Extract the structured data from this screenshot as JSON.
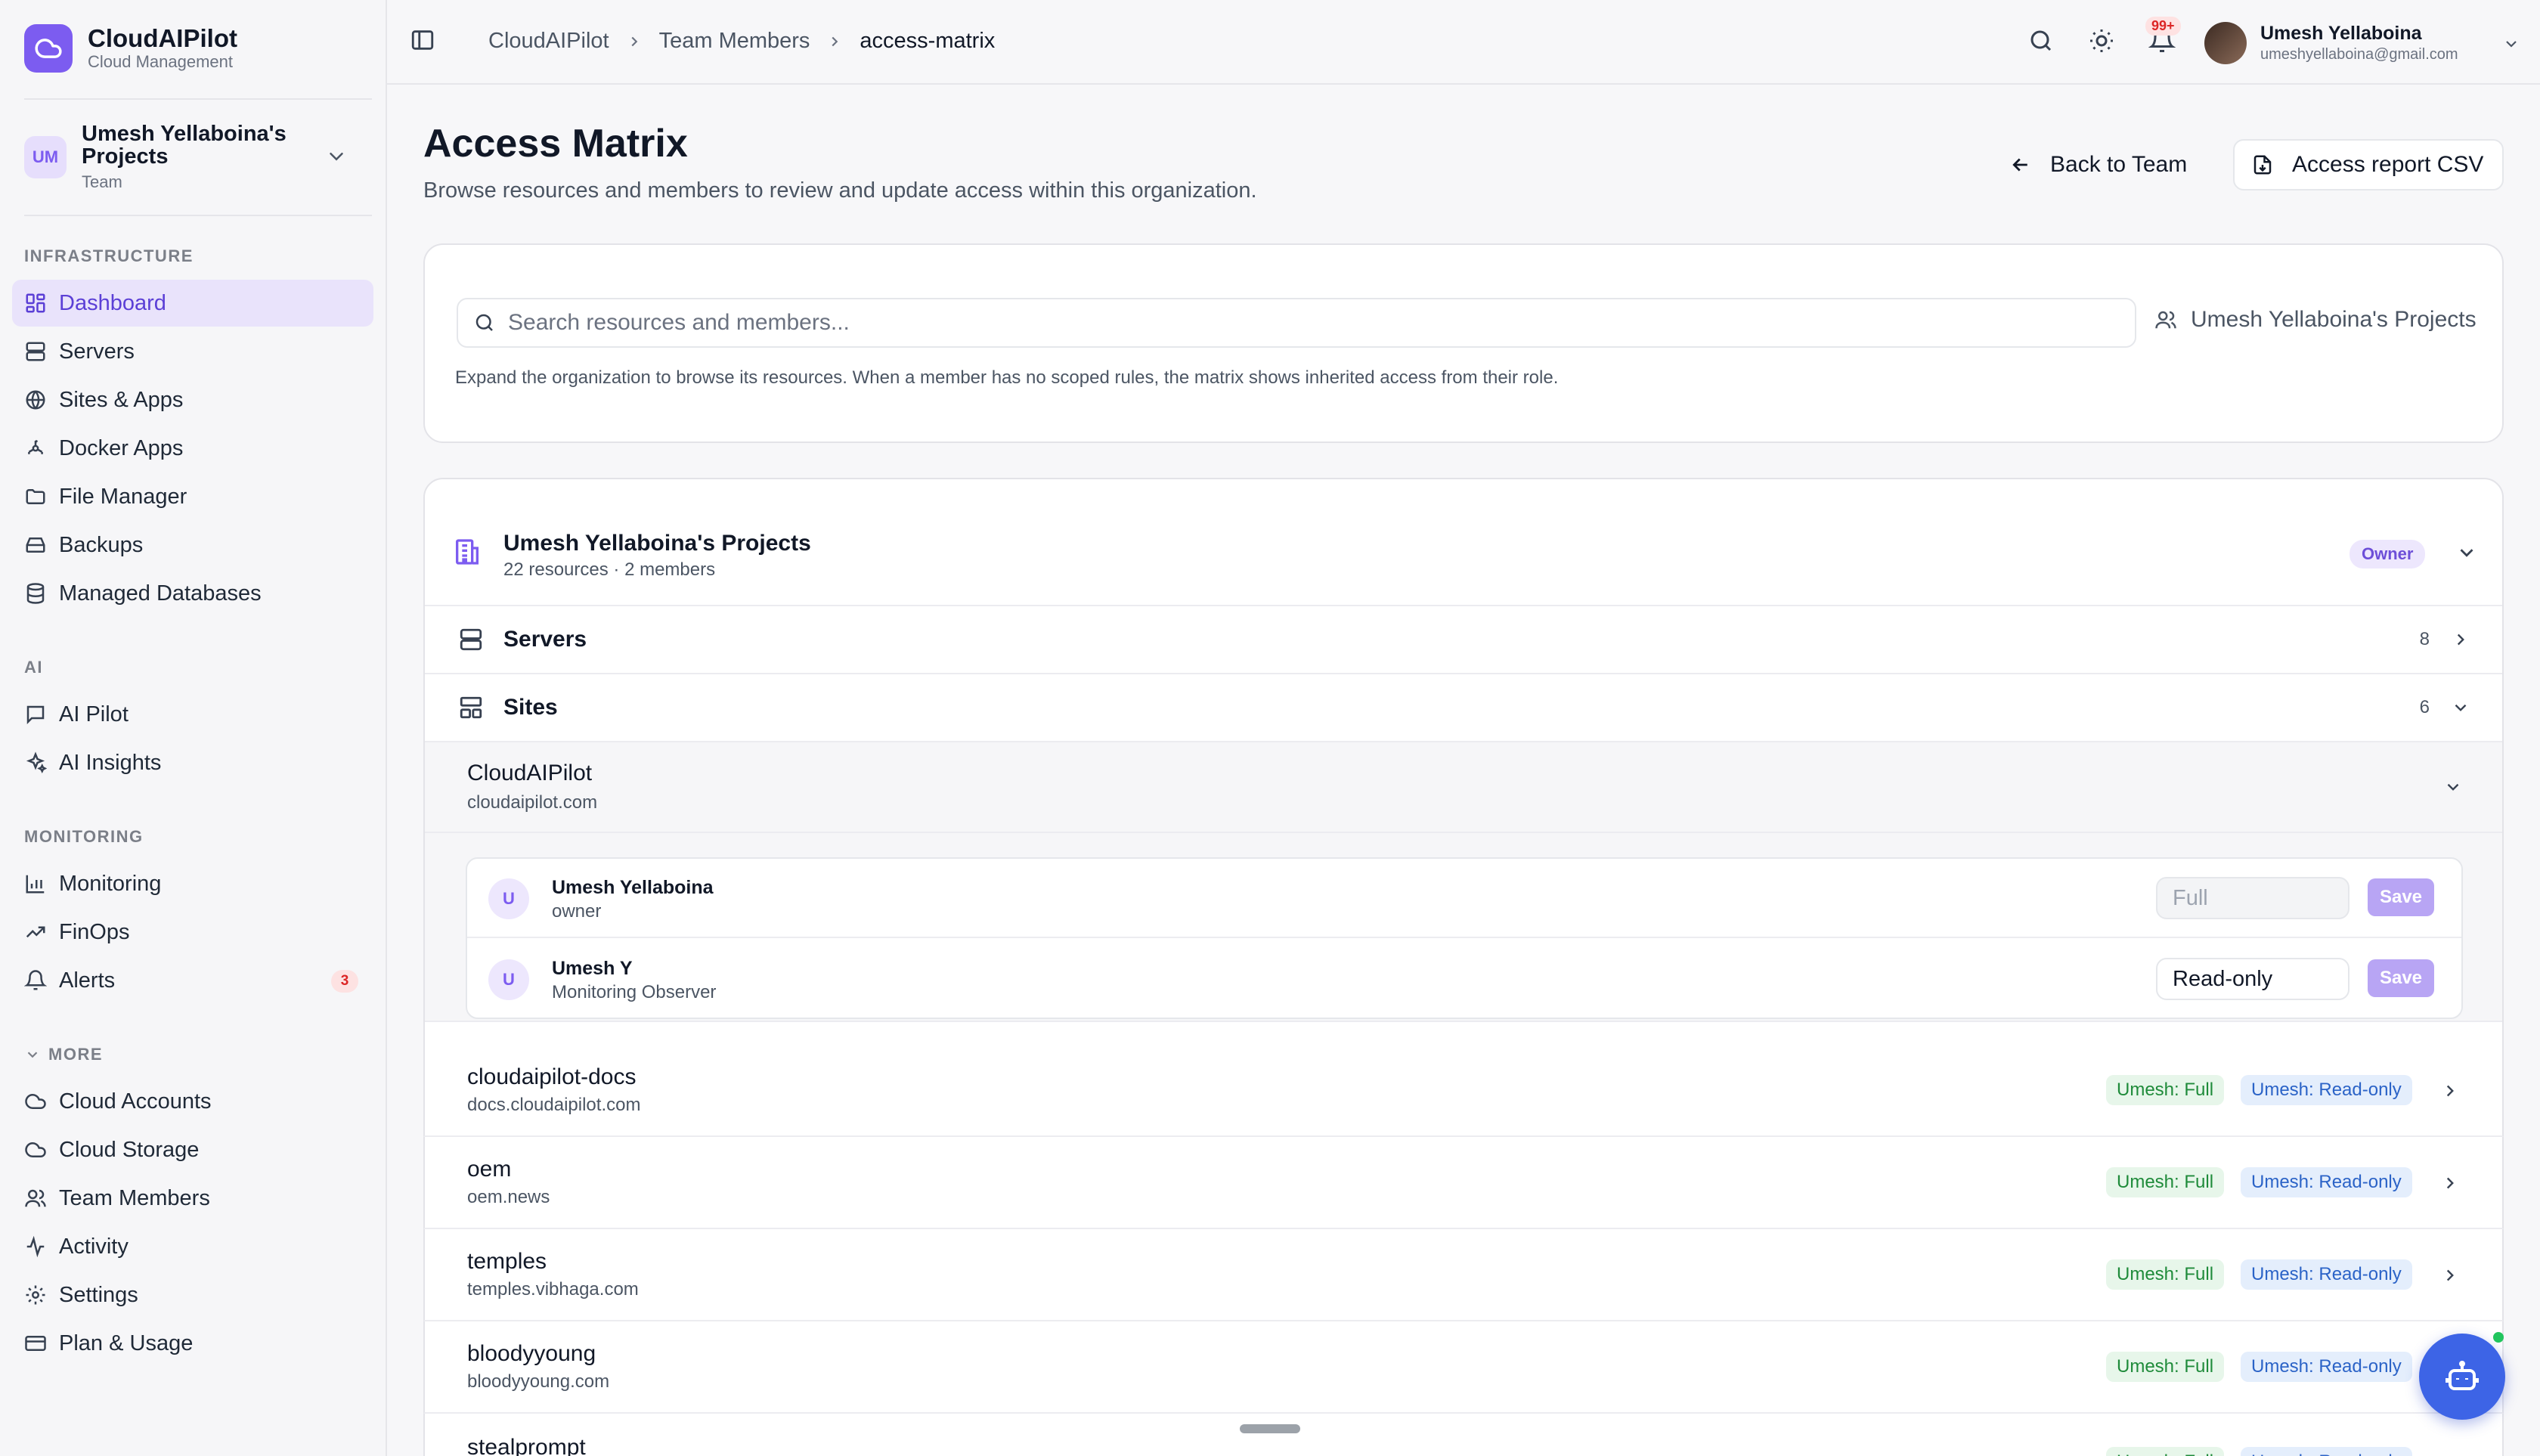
{
  "brand": {
    "name": "CloudAIPilot",
    "subtitle": "Cloud Management"
  },
  "org_switcher": {
    "initials": "UM",
    "name": "Umesh Yellaboina's Projects",
    "type": "Team"
  },
  "sidebar": {
    "sections": [
      {
        "label": "INFRASTRUCTURE",
        "items": [
          {
            "label": "Dashboard",
            "icon": "grid-icon",
            "active": true
          },
          {
            "label": "Servers",
            "icon": "server-icon"
          },
          {
            "label": "Sites & Apps",
            "icon": "globe-icon"
          },
          {
            "label": "Docker Apps",
            "icon": "docker-icon"
          },
          {
            "label": "File Manager",
            "icon": "folder-icon"
          },
          {
            "label": "Backups",
            "icon": "hard-drive-icon"
          },
          {
            "label": "Managed Databases",
            "icon": "database-icon"
          }
        ]
      },
      {
        "label": "AI",
        "items": [
          {
            "label": "AI Pilot",
            "icon": "chat-icon"
          },
          {
            "label": "AI Insights",
            "icon": "sparkles-icon"
          }
        ]
      },
      {
        "label": "MONITORING",
        "items": [
          {
            "label": "Monitoring",
            "icon": "bar-chart-icon"
          },
          {
            "label": "FinOps",
            "icon": "trending-up-icon"
          },
          {
            "label": "Alerts",
            "icon": "bell-icon",
            "badge": "3"
          }
        ]
      },
      {
        "label": "MORE",
        "items": [
          {
            "label": "Cloud Accounts",
            "icon": "cloud-icon"
          },
          {
            "label": "Cloud Storage",
            "icon": "cloud-icon"
          },
          {
            "label": "Team Members",
            "icon": "users-icon"
          },
          {
            "label": "Activity",
            "icon": "activity-icon"
          },
          {
            "label": "Settings",
            "icon": "gear-icon"
          },
          {
            "label": "Plan & Usage",
            "icon": "credit-card-icon"
          }
        ]
      }
    ]
  },
  "breadcrumb": [
    "CloudAIPilot",
    "Team Members",
    "access-matrix"
  ],
  "notifications": {
    "badge": "99+"
  },
  "user": {
    "name": "Umesh Yellaboina",
    "email": "umeshyellaboina@gmail.com"
  },
  "page": {
    "title": "Access Matrix",
    "description": "Browse resources and members to review and update access within this organization.",
    "back_label": "Back to Team",
    "csv_label": "Access report CSV"
  },
  "filter": {
    "search_placeholder": "Search resources and members...",
    "scope": "Umesh Yellaboina's Projects",
    "hint": "Expand the organization to browse its resources. When a member has no scoped rules, the matrix shows inherited access from their role."
  },
  "org_block": {
    "name": "Umesh Yellaboina's Projects",
    "meta": "22 resources · 2 members",
    "role_badge": "Owner",
    "groups": [
      {
        "label": "Servers",
        "count": "8"
      },
      {
        "label": "Sites",
        "count": "6"
      }
    ]
  },
  "sites": {
    "expanded": {
      "name": "CloudAIPilot",
      "domain": "cloudaipilot.com",
      "members": [
        {
          "initial": "U",
          "name": "Umesh Yellaboina",
          "role": "owner",
          "access": "Full",
          "save": "Save"
        },
        {
          "initial": "U",
          "name": "Umesh Y",
          "role": "Monitoring Observer",
          "access": "Read-only",
          "save": "Save"
        }
      ]
    },
    "list": [
      {
        "name": "cloudaipilot-docs",
        "domain": "docs.cloudaipilot.com",
        "full": "Umesh: Full",
        "ro": "Umesh: Read-only"
      },
      {
        "name": "oem",
        "domain": "oem.news",
        "full": "Umesh: Full",
        "ro": "Umesh: Read-only"
      },
      {
        "name": "temples",
        "domain": "temples.vibhaga.com",
        "full": "Umesh: Full",
        "ro": "Umesh: Read-only"
      },
      {
        "name": "bloodyyoung",
        "domain": "bloodyyoung.com",
        "full": "Umesh: Full",
        "ro": "Umesh: Read-only"
      },
      {
        "name": "stealprompt",
        "domain": "",
        "full": "Umesh: Full",
        "ro": "Umesh: Read-only"
      }
    ]
  },
  "colors": {
    "accent": "#7c5cf0",
    "fab": "#3d64e6",
    "full_pill": "#e7f6ea",
    "readonly_pill": "#e4eefc"
  }
}
